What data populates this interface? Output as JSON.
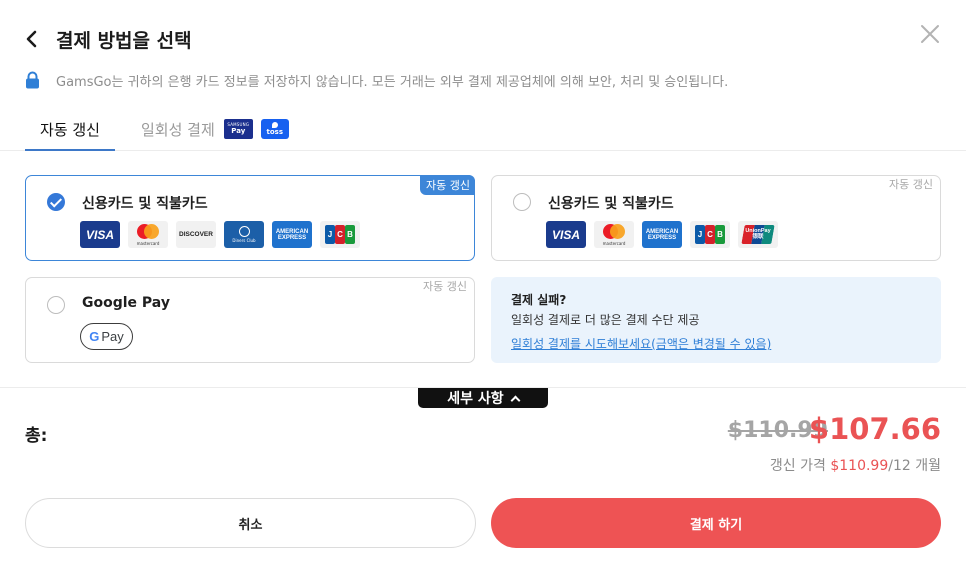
{
  "header": {
    "title": "결제 방법을 선택",
    "notice": "GamsGo는 귀하의 은행 카드 정보를 저장하지 않습니다. 모든 거래는 외부 결제 제공업체에 의해 보안, 처리 및 승인됩니다."
  },
  "tabs": {
    "auto_label": "자동 갱신",
    "once_label": "일회성 결제",
    "samsung_top": "SAMSUNG",
    "samsung_bottom": "Pay",
    "toss_label": "toss"
  },
  "options": {
    "card_auto": {
      "label": "신용카드 및 직불카드",
      "tag": "자동 갱신",
      "selected": true
    },
    "card_once": {
      "label": "신용카드 및 직불카드",
      "tag": "자동 갱신",
      "selected": false
    },
    "google_pay": {
      "label": "Google Pay",
      "tag": "자동 갱신",
      "selected": false,
      "badge_g": "G",
      "badge_pay": "Pay"
    }
  },
  "logos": {
    "visa": "VISA",
    "mastercard": "mastercard",
    "discover": "DISCOVER",
    "diners": "Diners Club",
    "amex_top": "AMERICAN",
    "amex_bottom": "EXPRESS",
    "jcb": [
      "J",
      "C",
      "B"
    ],
    "unionpay_top": "UnionPay",
    "unionpay_bottom": "银联"
  },
  "fail_box": {
    "title": "결제 실패?",
    "desc": "일회성 결제로 더 많은 결제 수단 제공",
    "link": "일회성 결제를 시도해보세요(금액은 변경될 수 있음)"
  },
  "summary": {
    "details_label": "세부 사항",
    "total_label": "총:",
    "price_old": "$110.99",
    "price_new": "$107.66",
    "renew_prefix": "갱신 가격 ",
    "renew_price": "$110.99",
    "renew_suffix": "/12 개월"
  },
  "actions": {
    "cancel": "취소",
    "pay": "결제 하기"
  },
  "colors": {
    "accent_blue": "#3478d8",
    "price_red": "#ea5354",
    "pay_button": "#ee5354",
    "fail_bg": "#eaf3fc"
  }
}
